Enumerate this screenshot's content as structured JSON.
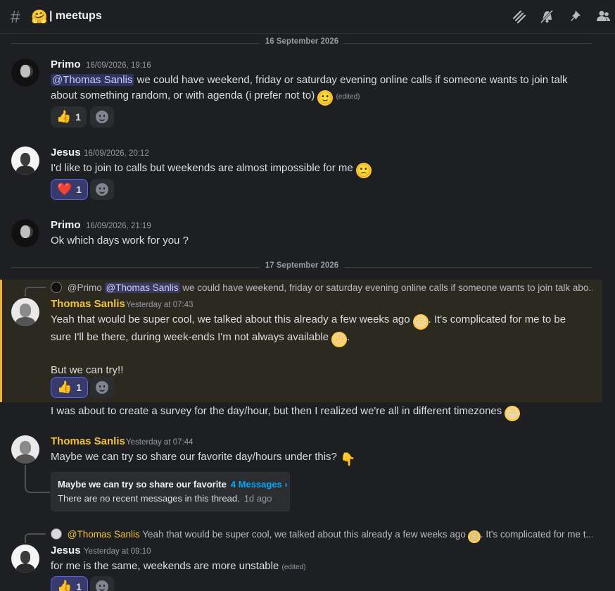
{
  "channel": {
    "hash": "#",
    "emoji": "🤗",
    "name": "| meetups"
  },
  "header_icons": [
    "threads-icon",
    "notifications-muted-icon",
    "pin-icon",
    "members-icon"
  ],
  "dividers": {
    "first": "16 September 2026",
    "second": "17 September 2026"
  },
  "messages": [
    {
      "author": "Primo",
      "timestamp": "16/09/2026, 19:16",
      "mention": "@Thomas Sanlis",
      "text": "we could have weekend, friday or saturday evening online calls if someone wants to join talk about something random, or with agenda (i prefer not to)",
      "edited": "(edited)",
      "reaction": {
        "emoji": "👍",
        "count": "1"
      }
    },
    {
      "author": "Jesus",
      "timestamp": "16/09/2026, 20:12",
      "text": "I'd like to join to calls but weekends are almost impossible for me",
      "reaction": {
        "emoji": "❤️",
        "count": "1"
      }
    },
    {
      "author": "Primo",
      "timestamp": "16/09/2026, 21:19",
      "text": "Ok which days work for you ?"
    },
    {
      "reply_author": "@Primo",
      "reply_mention": "@Thomas Sanlis",
      "reply_text": "we could have weekend, friday or saturday evening online calls if someone wants to join talk abo...",
      "author": "Thomas Sanlis",
      "timestamp": "Yesterday at 07:43",
      "line1": "Yeah that would be super cool, we talked about this already a few weeks ago",
      "line1_end": ". It's complicated for me to be",
      "line2": "sure I'll be there, during week-ends I'm not always available",
      "line2_end": ".",
      "line3": "But we can try!!",
      "reaction": {
        "emoji": "👍",
        "count": "1"
      }
    },
    {
      "text": "I was about to create a survey for the day/hour, but then I realized we're all in different timezones"
    },
    {
      "author": "Thomas Sanlis",
      "timestamp": "Yesterday at 07:44",
      "text": "Maybe we can try so share our favorite day/hours under this?",
      "thread": {
        "title": "Maybe we can try so share our favorite",
        "count": "4 Messages ›",
        "status": "There are no recent messages in this thread.",
        "ago": "1d ago"
      }
    },
    {
      "reply_author": "@Thomas Sanlis",
      "reply_text": "Yeah that would be super cool, we talked about this already a few weeks ago",
      "reply_text_end": ". It's complicated for me t...",
      "author": "Jesus",
      "timestamp": "Yesterday at 09:10",
      "text": "for me is the same, weekends are more unstable",
      "edited": "(edited)",
      "reaction": {
        "emoji": "👍",
        "count": "1"
      }
    }
  ],
  "emojis": {
    "slight_smile": "🙂",
    "slight_frown": "🙁",
    "grin_sweat": "😅",
    "confused": "😕",
    "joy": "😂",
    "point_down": "👇"
  },
  "colors": {
    "background": "#1e1f22",
    "highlight": "#2c2920",
    "highlight_border": "#f0b232",
    "mention_bg": "#3c4270",
    "gold_name": "#f0c23c",
    "link_blue": "#00a8fc"
  }
}
